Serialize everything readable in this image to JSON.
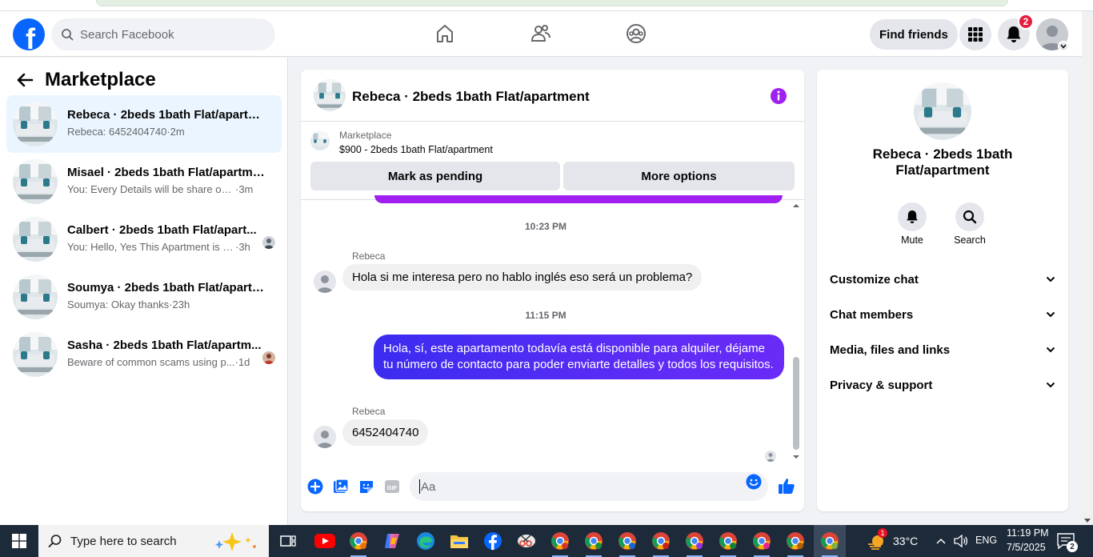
{
  "header": {
    "search_placeholder": "Search Facebook",
    "find_friends_label": "Find friends",
    "notification_count": "2",
    "logo_letter": "f"
  },
  "sidebar": {
    "title": "Marketplace",
    "conversations": [
      {
        "title": "Rebeca · 2beds 1bath Flat/apartme...",
        "snippet": "Rebeca: 6452404740",
        "time": "·2m",
        "active": true
      },
      {
        "title": "Misael · 2beds 1bath Flat/apartment",
        "snippet": "You: Every Details will be share on yo...",
        "time": "·3m"
      },
      {
        "title": "Calbert · 2beds 1bath Flat/apart...",
        "snippet": "You: Hello, Yes This Apartment is sti...",
        "time": "·3h"
      },
      {
        "title": "Soumya · 2beds 1bath Flat/apartm...",
        "snippet": "Soumya: Okay thanks",
        "time": "·23h"
      },
      {
        "title": "Sasha · 2beds 1bath Flat/apartm...",
        "snippet": "Beware of common scams using p...",
        "time": "·1d"
      }
    ]
  },
  "chat": {
    "title": "Rebeca · 2beds 1bath Flat/apartment",
    "listing_type": "Marketplace",
    "listing_title": "$900 - 2beds 1bath Flat/apartment",
    "mark_pending_label": "Mark as pending",
    "more_options_label": "More options",
    "messages": [
      {
        "kind": "time",
        "text": "10:23 PM"
      },
      {
        "kind": "in",
        "sender": "Rebeca",
        "text": "Hola si me interesa pero no hablo inglés eso será un problema?"
      },
      {
        "kind": "time",
        "text": "11:15 PM"
      },
      {
        "kind": "out",
        "text": "Hola, sí, este apartamento todavía está disponible para alquiler, déjame tu número de contacto para poder enviarte detalles y todos los requisitos."
      },
      {
        "kind": "in",
        "sender": "Rebeca",
        "text": "6452404740"
      }
    ],
    "composer_placeholder": "Aa"
  },
  "info_panel": {
    "name": "Rebeca · 2beds 1bath Flat/apartment",
    "mute_label": "Mute",
    "search_label": "Search",
    "sections": [
      "Customize chat",
      "Chat members",
      "Media, files and links",
      "Privacy & support"
    ]
  },
  "taskbar": {
    "search_placeholder": "Type here to search",
    "weather": "33°C",
    "weather_badge": "1",
    "language": "ENG",
    "time": "11:19 PM",
    "date": "7/5/2025",
    "notifications": "2"
  },
  "colors": {
    "brand": "#0866ff",
    "outgoing_bubble": "#4a2cf3",
    "info_icon": "#a020f0",
    "notif_badge": "#e41e3f"
  }
}
